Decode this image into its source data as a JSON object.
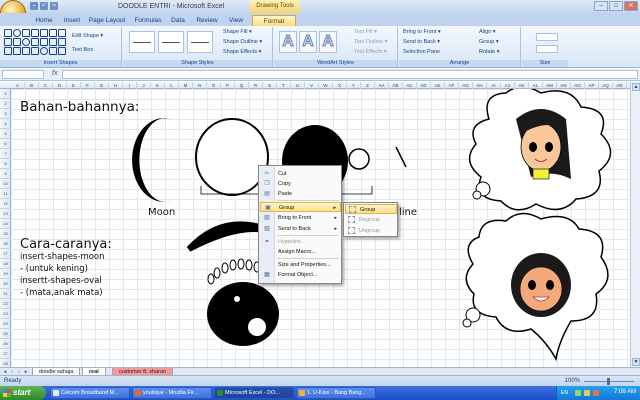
{
  "window": {
    "title": "DOODLE ENTRI - Microsoft Excel",
    "context_tool": "Drawing Tools",
    "buttons": [
      "–",
      "□",
      "✕"
    ]
  },
  "tabs": [
    "Home",
    "Insert",
    "Page Layout",
    "Formulas",
    "Data",
    "Review",
    "View",
    "Format"
  ],
  "active_tab": "Format",
  "ribbon": {
    "insert_shapes": {
      "label": "Insert Shapes",
      "edit_shape": "Edit Shape ▾",
      "text_box": "Text Box"
    },
    "shape_styles": {
      "label": "Shape Styles",
      "fill": "Shape Fill ▾",
      "outline": "Shape Outline ▾",
      "effects": "Shape Effects ▾"
    },
    "wordart_styles": {
      "label": "WordArt Styles",
      "glyph": "A",
      "fill": "Text Fill ▾",
      "outline": "Text Outline ▾",
      "effects": "Text Effects ▾"
    },
    "arrange": {
      "label": "Arrange",
      "bring_front": "Bring to Front ▾",
      "send_back": "Send to Back ▾",
      "selection_pane": "Selection Pane",
      "align": "Align ▾",
      "group": "Group ▾",
      "rotate": "Rotate ▾"
    },
    "size": {
      "label": "Size"
    }
  },
  "formula_bar": {
    "fx": "fx"
  },
  "columns": [
    "A",
    "B",
    "C",
    "D",
    "E",
    "F",
    "G",
    "H",
    "I",
    "J",
    "K",
    "L",
    "M",
    "N",
    "O",
    "P",
    "Q",
    "R",
    "S",
    "T",
    "U",
    "V",
    "W",
    "X",
    "Y",
    "Z",
    "AA",
    "AB",
    "AC",
    "AD",
    "AE",
    "AF",
    "AG",
    "AH",
    "AI",
    "AJ",
    "AK",
    "AL",
    "AM",
    "AN",
    "AO",
    "AP",
    "AQ",
    "AR"
  ],
  "rows": [
    "1",
    "2",
    "3",
    "4",
    "5",
    "6",
    "7",
    "8",
    "9",
    "10",
    "11",
    "12",
    "13",
    "14",
    "15",
    "16",
    "17",
    "18",
    "19",
    "20",
    "21",
    "22",
    "23",
    "24",
    "25",
    "26",
    "27",
    "28"
  ],
  "sheet": {
    "heading_materials": "Bahan-bahannya:",
    "label_moon": "Moon",
    "label_line": "line",
    "heading_steps": "Cara-caranya:",
    "steps": [
      "insert-shapes-moon",
      "- (untuk kening)",
      "insertt-shapes-oval",
      "- (mata,anak mata)"
    ]
  },
  "context_menu": {
    "items": [
      {
        "label": "Cut",
        "icon": "scissors-icon",
        "glyph": "✂",
        "disabled": false
      },
      {
        "label": "Copy",
        "icon": "copy-icon",
        "glyph": "❐",
        "disabled": false
      },
      {
        "label": "Paste",
        "icon": "paste-icon",
        "glyph": "▤",
        "disabled": false
      },
      {
        "label": "Group",
        "icon": "group-icon",
        "glyph": "▣",
        "disabled": false,
        "submenu": true
      },
      {
        "label": "Bring to Front",
        "icon": "bring-front-icon",
        "glyph": "▧",
        "disabled": false,
        "submenu": true
      },
      {
        "label": "Send to Back",
        "icon": "send-back-icon",
        "glyph": "▨",
        "disabled": false,
        "submenu": true
      },
      {
        "label": "Hyperlink...",
        "icon": "hyperlink-icon",
        "glyph": "⚭",
        "disabled": true
      },
      {
        "label": "Assign Macro...",
        "disabled": false
      },
      {
        "label": "Size and Properties...",
        "disabled": false
      },
      {
        "label": "Format Object...",
        "icon": "format-icon",
        "glyph": "▦",
        "disabled": false
      }
    ],
    "arrow": "▸",
    "highlighted_index": 3
  },
  "group_submenu": {
    "items": [
      {
        "label": "Group",
        "disabled": false
      },
      {
        "label": "Regroup",
        "disabled": true
      },
      {
        "label": "Ungroup",
        "disabled": true
      }
    ]
  },
  "sheet_tabs": [
    "doodle sahaja",
    "real",
    "customer ft. sharon"
  ],
  "active_sheet": "real",
  "status": {
    "ready": "Ready",
    "zoom": "100%"
  },
  "taskbar": {
    "start": "start",
    "items": [
      {
        "label": "Celcom Broadband M...",
        "color": "#e8ecf5"
      },
      {
        "label": "youtique - Mozilla Fir...",
        "color": "#e86a2a"
      },
      {
        "label": "Microsoft Excel - DO...",
        "color": "#2f8a3a",
        "active": true
      },
      {
        "label": "1. U-Kiss - Bang Bang...",
        "color": "#f0b23a"
      }
    ],
    "tray_lang": "EN",
    "clock": "7:06 AM"
  },
  "colors": {
    "ribbon_accent": "#15428b",
    "context_tab": "#f9dc84",
    "menu_highlight": "#fedf8a",
    "taskbar": "#245edb"
  }
}
